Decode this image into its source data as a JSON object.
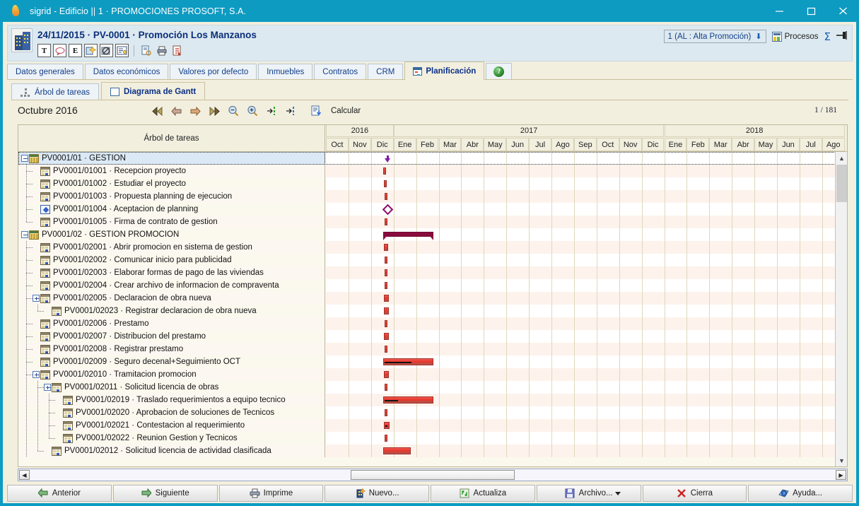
{
  "window": {
    "title": "sigrid - Edificio || 1 · PROMOCIONES PROSOFT, S.A.",
    "app_icon": "flame-icon",
    "minimize": "minimize-icon",
    "maximize": "maximize-icon",
    "close": "close-icon"
  },
  "record_header": {
    "title": "24/11/2015 · PV-0001 · Promoción Los Manzanos",
    "icon": "building-icon",
    "tools": [
      {
        "name": "text-tool-button",
        "glyph": "T"
      },
      {
        "name": "comment-tool-button",
        "glyph": "◯"
      },
      {
        "name": "email-tool-button",
        "glyph": "E"
      },
      {
        "name": "wizard-tool-button",
        "glyph": ""
      },
      {
        "name": "attachment-tool-button",
        "glyph": ""
      },
      {
        "name": "notes-tool-button",
        "glyph": ""
      },
      {
        "name": "preview-tool-button",
        "glyph": ""
      },
      {
        "name": "print-tool-button",
        "glyph": ""
      },
      {
        "name": "pdf-tool-button",
        "glyph": ""
      }
    ],
    "promotion_selector": "1 (AL : Alta Promoción)",
    "procesos_label": "Procesos",
    "sigma_label": "Σ",
    "pin_label": "pin-icon"
  },
  "tabs": [
    {
      "label": "Datos generales",
      "active": false
    },
    {
      "label": "Datos económicos",
      "active": false
    },
    {
      "label": "Valores por defecto",
      "active": false
    },
    {
      "label": "Inmuebles",
      "active": false
    },
    {
      "label": "Contratos",
      "active": false
    },
    {
      "label": "CRM",
      "active": false
    },
    {
      "label": "Planificación",
      "active": true
    }
  ],
  "help_tab": {
    "label": "?",
    "name": "help-tab"
  },
  "subtabs": [
    {
      "label": "Árbol de tareas",
      "active": false,
      "icon": "tree-icon"
    },
    {
      "label": "Diagrama de Gantt",
      "active": true,
      "icon": "gantt-icon"
    }
  ],
  "gantt_toolbar": {
    "month_label": "Octubre 2016",
    "page_count": "1 / 181",
    "calcular_label": "Calcular",
    "buttons": [
      {
        "name": "first-button",
        "icon": "double-arrow-left-icon"
      },
      {
        "name": "previous-button",
        "icon": "arrow-left-icon"
      },
      {
        "name": "next-button",
        "icon": "arrow-right-icon"
      },
      {
        "name": "last-button",
        "icon": "double-arrow-right-icon"
      },
      {
        "name": "zoom-out-button",
        "icon": "magnifier-minus-icon"
      },
      {
        "name": "zoom-in-button",
        "icon": "magnifier-plus-icon"
      },
      {
        "name": "go-to-start-button",
        "icon": "arrow-to-line-green-icon"
      },
      {
        "name": "go-to-end-button",
        "icon": "arrow-to-line-blue-icon"
      },
      {
        "name": "calcular-button",
        "icon": "calculate-icon"
      }
    ]
  },
  "grid": {
    "tree_column_header": "Árbol de tareas",
    "years": [
      {
        "label": "2016",
        "months": 3
      },
      {
        "label": "2017",
        "months": 12
      },
      {
        "label": "2018",
        "months": 8
      }
    ],
    "months": [
      "Oct",
      "Nov",
      "Dic",
      "Ene",
      "Feb",
      "Mar",
      "Abr",
      "May",
      "Jun",
      "Jul",
      "Ago",
      "Sep",
      "Oct",
      "Nov",
      "Dic",
      "Ene",
      "Feb",
      "Mar",
      "Abr",
      "May",
      "Jun",
      "Jul",
      "Ago"
    ]
  },
  "chart_data": {
    "type": "bar",
    "title": "Diagrama de Gantt · Octubre 2016",
    "xlabel": "",
    "ylabel": "",
    "rows": [
      {
        "id": "PV0001/01",
        "name": "GESTION",
        "indent": 0,
        "icon": "folder-icon",
        "expander": "minus",
        "selected": true,
        "bar": {
          "type": "arrow-down",
          "start": 2.55,
          "span": 0.3
        }
      },
      {
        "id": "PV0001/01001",
        "name": "Recepcion proyecto",
        "indent": 1,
        "icon": "task-icon",
        "expander": "none",
        "selected": false,
        "bar": {
          "type": "task",
          "start": 2.55,
          "span": 0.12,
          "progress": 0
        }
      },
      {
        "id": "PV0001/01002",
        "name": "Estudiar el proyecto",
        "indent": 1,
        "icon": "task-icon",
        "expander": "none",
        "selected": false,
        "bar": {
          "type": "task",
          "start": 2.57,
          "span": 0.12,
          "progress": 0
        }
      },
      {
        "id": "PV0001/01003",
        "name": "Propuesta planning de ejecucion",
        "indent": 1,
        "icon": "task-icon",
        "expander": "none",
        "selected": false,
        "bar": {
          "type": "task",
          "start": 2.59,
          "span": 0.12,
          "progress": 0
        }
      },
      {
        "id": "PV0001/01004",
        "name": "Aceptacion de planning",
        "indent": 1,
        "icon": "milestone-icon",
        "expander": "none",
        "selected": false,
        "bar": {
          "type": "milestone",
          "start": 2.53,
          "span": 0.35
        }
      },
      {
        "id": "PV0001/01005",
        "name": "Firma de contrato de gestion",
        "indent": 1,
        "icon": "task-icon",
        "expander": "none",
        "selected": false,
        "bar": {
          "type": "task",
          "start": 2.6,
          "span": 0.12,
          "progress": 0
        }
      },
      {
        "id": "PV0001/02",
        "name": "GESTION PROMOCION",
        "indent": 0,
        "icon": "folder-icon",
        "expander": "minus",
        "selected": false,
        "bar": {
          "type": "summary",
          "start": 2.55,
          "span": 2.2
        }
      },
      {
        "id": "PV0001/02001",
        "name": "Abrir promocion en sistema de gestion",
        "indent": 1,
        "icon": "task-icon",
        "expander": "none",
        "selected": false,
        "bar": {
          "type": "task",
          "start": 2.57,
          "span": 0.2,
          "progress": 0
        }
      },
      {
        "id": "PV0001/02002",
        "name": "Comunicar inicio para publicidad",
        "indent": 1,
        "icon": "task-icon",
        "expander": "none",
        "selected": false,
        "bar": {
          "type": "task",
          "start": 2.6,
          "span": 0.12,
          "progress": 0
        }
      },
      {
        "id": "PV0001/02003",
        "name": "Elaborar formas de pago de las viviendas",
        "indent": 1,
        "icon": "task-icon",
        "expander": "none",
        "selected": false,
        "bar": {
          "type": "task",
          "start": 2.6,
          "span": 0.12,
          "progress": 0
        }
      },
      {
        "id": "PV0001/02004",
        "name": "Crear archivo de informacion de compraventa",
        "indent": 1,
        "icon": "task-icon",
        "expander": "none",
        "selected": false,
        "bar": {
          "type": "task",
          "start": 2.6,
          "span": 0.12,
          "progress": 0
        }
      },
      {
        "id": "PV0001/02005",
        "name": "Declaracion de obra nueva",
        "indent": 1,
        "icon": "task-icon",
        "expander": "plus",
        "selected": false,
        "bar": {
          "type": "task",
          "start": 2.58,
          "span": 0.2,
          "progress": 0
        }
      },
      {
        "id": "PV0001/02023",
        "name": "Registrar declaracion de obra nueva",
        "indent": 2,
        "icon": "task-icon",
        "expander": "none",
        "selected": false,
        "bar": {
          "type": "task",
          "start": 2.58,
          "span": 0.2,
          "progress": 0
        }
      },
      {
        "id": "PV0001/02006",
        "name": "Prestamo",
        "indent": 1,
        "icon": "task-icon",
        "expander": "none",
        "selected": false,
        "bar": {
          "type": "task",
          "start": 2.6,
          "span": 0.12,
          "progress": 0
        }
      },
      {
        "id": "PV0001/02007",
        "name": "Distribucion del prestamo",
        "indent": 1,
        "icon": "task-icon",
        "expander": "none",
        "selected": false,
        "bar": {
          "type": "task",
          "start": 2.58,
          "span": 0.2,
          "progress": 0
        }
      },
      {
        "id": "PV0001/02008",
        "name": "Registrar prestamo",
        "indent": 1,
        "icon": "task-icon",
        "expander": "none",
        "selected": false,
        "bar": {
          "type": "task",
          "start": 2.6,
          "span": 0.12,
          "progress": 0
        }
      },
      {
        "id": "PV0001/02009",
        "name": "Seguro decenal+Seguimiento OCT",
        "indent": 1,
        "icon": "task-icon",
        "expander": "none",
        "selected": false,
        "bar": {
          "type": "task",
          "start": 2.55,
          "span": 2.2,
          "progress": 55
        }
      },
      {
        "id": "PV0001/02010",
        "name": "Tramitacion promocion",
        "indent": 1,
        "icon": "task-icon",
        "expander": "plus",
        "selected": false,
        "bar": {
          "type": "task",
          "start": 2.58,
          "span": 0.2,
          "progress": 0
        }
      },
      {
        "id": "PV0001/02011",
        "name": "Solicitud licencia de obras",
        "indent": 2,
        "icon": "task-icon",
        "expander": "plus",
        "selected": false,
        "bar": {
          "type": "task",
          "start": 2.6,
          "span": 0.12,
          "progress": 0
        }
      },
      {
        "id": "PV0001/02019",
        "name": "Traslado requerimientos a equipo tecnico",
        "indent": 3,
        "icon": "task-icon",
        "expander": "none",
        "selected": false,
        "bar": {
          "type": "task",
          "start": 2.55,
          "span": 2.2,
          "progress": 28
        }
      },
      {
        "id": "PV0001/02020",
        "name": "Aprobacion de soluciones de Tecnicos",
        "indent": 3,
        "icon": "task-icon",
        "expander": "none",
        "selected": false,
        "bar": {
          "type": "task",
          "start": 2.6,
          "span": 0.12,
          "progress": 0
        }
      },
      {
        "id": "PV0001/02021",
        "name": "Contestacion al requerimiento",
        "indent": 3,
        "icon": "task-icon",
        "expander": "none",
        "selected": false,
        "bar": {
          "type": "task",
          "start": 2.58,
          "span": 0.25,
          "progress": 40
        }
      },
      {
        "id": "PV0001/02022",
        "name": "Reunion Gestion y Tecnicos",
        "indent": 3,
        "icon": "task-icon",
        "expander": "none",
        "selected": false,
        "bar": {
          "type": "task",
          "start": 2.6,
          "span": 0.12,
          "progress": 0
        }
      },
      {
        "id": "PV0001/02012",
        "name": "Solicitud licencia de actividad clasificada",
        "indent": 2,
        "icon": "task-icon",
        "expander": "none",
        "selected": false,
        "bar": {
          "type": "task",
          "start": 2.55,
          "span": 1.2,
          "progress": 0
        }
      }
    ]
  },
  "bottom_bar": [
    {
      "label": "Anterior",
      "icon": "arrow-left-green-icon",
      "name": "previous-button"
    },
    {
      "label": "Siguiente",
      "icon": "arrow-right-green-icon",
      "name": "next-button"
    },
    {
      "label": "Imprime",
      "icon": "printer-icon",
      "name": "print-button"
    },
    {
      "label": "Nuevo...",
      "icon": "new-record-icon",
      "name": "new-button"
    },
    {
      "label": "Actualiza",
      "icon": "refresh-icon",
      "name": "update-button"
    },
    {
      "label": "Archivo...",
      "icon": "save-icon",
      "name": "archive-button",
      "has_caret": true
    },
    {
      "label": "Cierra",
      "icon": "close-x-icon",
      "name": "close-button"
    },
    {
      "label": "Ayuda...",
      "icon": "help-icon",
      "name": "help-button"
    }
  ]
}
